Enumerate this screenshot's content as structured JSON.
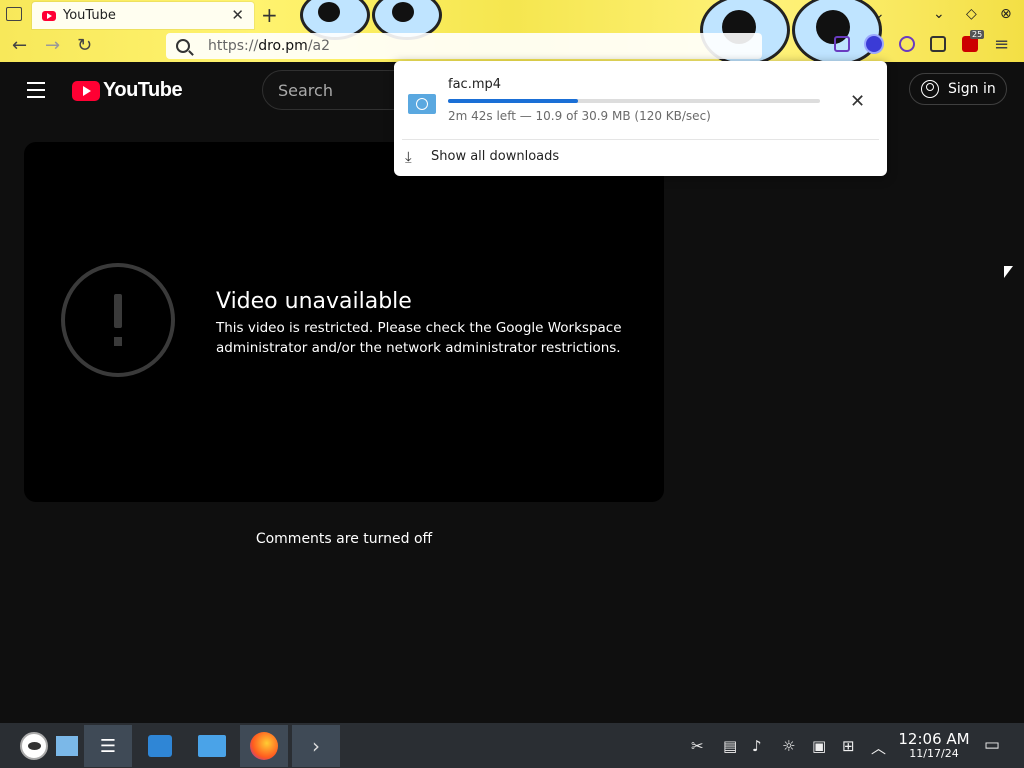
{
  "browser": {
    "tab_title": "YouTube",
    "url_prefix": "https://",
    "url_domain": "dro.pm",
    "url_path": "/a2",
    "ublock_count": "25"
  },
  "youtube": {
    "logo_text": "YouTube",
    "search_placeholder": "Search",
    "sign_in_label": "Sign in",
    "video_error_title": "Video unavailable",
    "video_error_message": "This video is restricted. Please check the Google Workspace administrator and/or the network administrator restrictions.",
    "comments_status": "Comments are turned off"
  },
  "downloads": {
    "filename": "fac.mp4",
    "status": "2m 42s left — 10.9 of 30.9 MB (120 KB/sec)",
    "progress_fraction": 0.35,
    "show_all_label": "Show all downloads"
  },
  "taskbar": {
    "time": "12:06 AM",
    "date": "11/17/24"
  },
  "colors": {
    "yt_red": "#ff0033",
    "progress_blue": "#1a6fd6",
    "page_bg": "#0f0f0f"
  }
}
